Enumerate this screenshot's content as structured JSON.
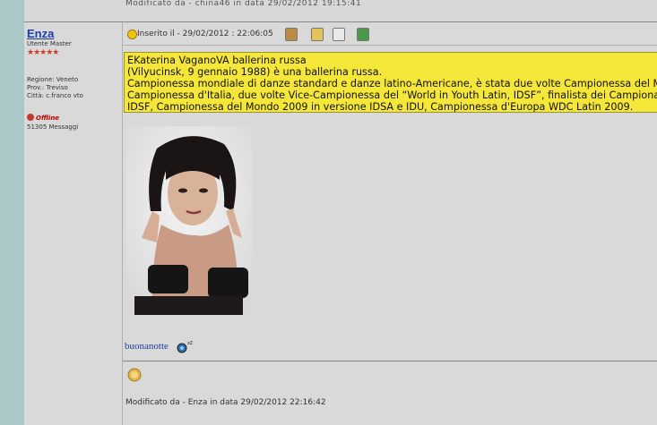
{
  "top_modified": "Modificato da - china46 in data 29/02/2012 19:15:41",
  "user": {
    "name": "Enza",
    "role": "Utente Master",
    "stars": "★★★★★",
    "region": "Regione: Veneto",
    "province": "Prov.: Treviso",
    "city": "Città: c.franco vto",
    "status": "Offline",
    "messages": "51305 Messaggi"
  },
  "post": {
    "inserted": "Inserito il - 29/02/2012 : 22:06:05",
    "body": [
      "EKaterina VaganoVA ballerina russa",
      "(Vilyucinsk, 9 gennaio 1988) è una ballerina russa.",
      "Campionessa mondiale di danze standard e danze latino-Americane, è stata due volte Campionessa del Mondo,",
      "Campionessa d'Italia, due volte Vice-Campionessa del “World in Youth Latin, IDSF”, finalista dei Campionati",
      "IDSF, Campionessa del Mondo 2009 in versione IDSA e IDU, Campionessa d'Europa WDC Latin 2009."
    ],
    "closing": "buonanotte",
    "modified": "Modificato da - Enza in data 29/02/2012 22:16:42"
  },
  "colors": {
    "highlight": "#f5e63a",
    "link": "#1a3ea8",
    "left_strip": "#aac8c8"
  }
}
